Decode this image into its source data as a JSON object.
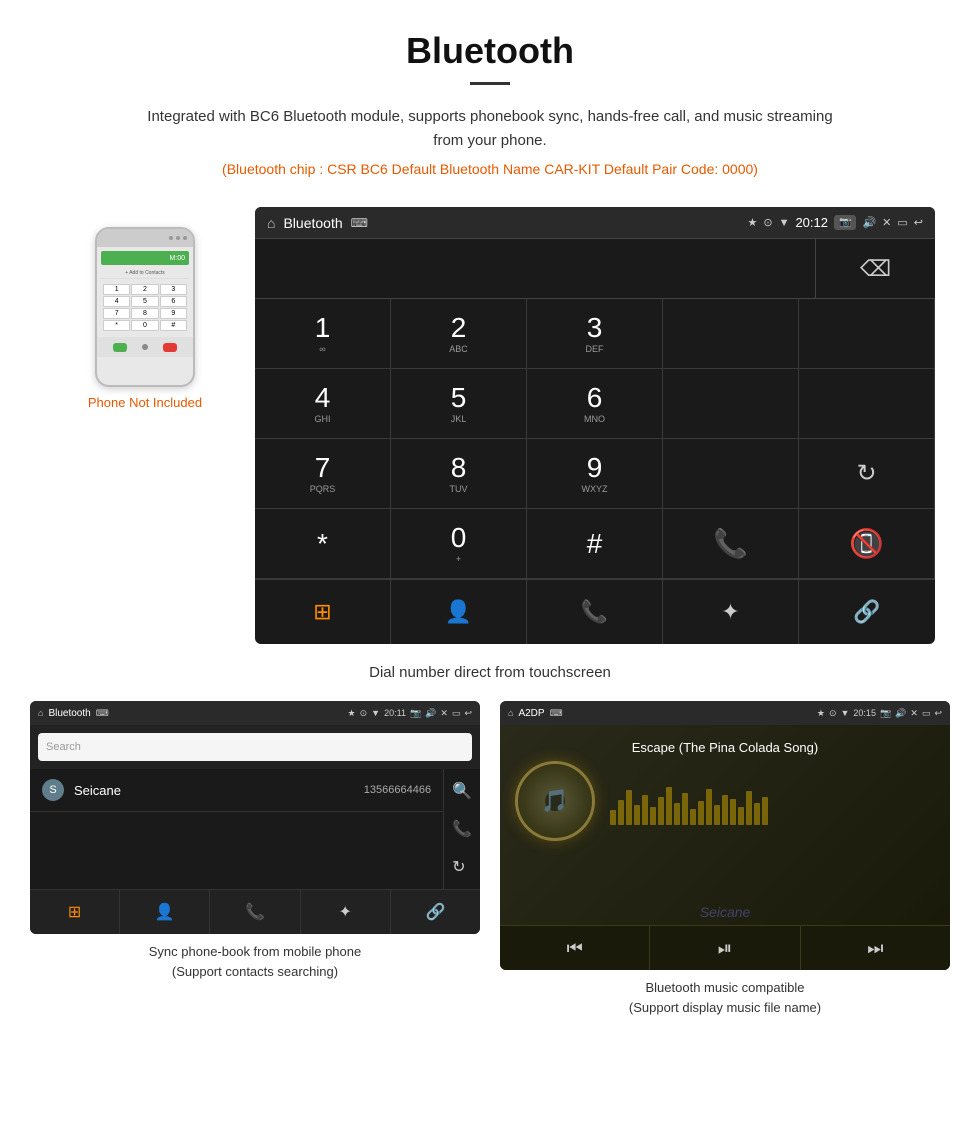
{
  "header": {
    "title": "Bluetooth",
    "description": "Integrated with BC6 Bluetooth module, supports phonebook sync, hands-free call, and music streaming from your phone.",
    "specs": "(Bluetooth chip : CSR BC6   Default Bluetooth Name CAR-KIT    Default Pair Code: 0000)"
  },
  "dial_screen": {
    "status_bar": {
      "title": "Bluetooth",
      "usb_icon": "⌨",
      "time": "20:12",
      "icons": [
        "★",
        "⊙",
        "▼"
      ]
    },
    "keys": [
      {
        "num": "1",
        "alpha": "∞"
      },
      {
        "num": "2",
        "alpha": "ABC"
      },
      {
        "num": "3",
        "alpha": "DEF"
      },
      {
        "num": "",
        "alpha": ""
      },
      {
        "num": "⌫",
        "alpha": ""
      },
      {
        "num": "4",
        "alpha": "GHI"
      },
      {
        "num": "5",
        "alpha": "JKL"
      },
      {
        "num": "6",
        "alpha": "MNO"
      },
      {
        "num": "",
        "alpha": ""
      },
      {
        "num": "",
        "alpha": ""
      },
      {
        "num": "7",
        "alpha": "PQRS"
      },
      {
        "num": "8",
        "alpha": "TUV"
      },
      {
        "num": "9",
        "alpha": "WXYZ"
      },
      {
        "num": "",
        "alpha": ""
      },
      {
        "num": "↻",
        "alpha": ""
      },
      {
        "num": "*",
        "alpha": ""
      },
      {
        "num": "0",
        "alpha": "+"
      },
      {
        "num": "#",
        "alpha": ""
      },
      {
        "num": "📞",
        "alpha": ""
      },
      {
        "num": "📵",
        "alpha": ""
      }
    ],
    "toolbar": [
      "⊞",
      "👤",
      "📞",
      "✦",
      "🔗"
    ]
  },
  "dial_caption": "Dial number direct from touchscreen",
  "phone_not_included": "Phone Not Included",
  "phonebook_screen": {
    "status_bar_title": "Bluetooth",
    "status_bar_time": "20:11",
    "search_placeholder": "Search",
    "contact_name": "Seicane",
    "contact_number": "13566664466",
    "contact_letter": "S",
    "toolbar_icons": [
      "⊞",
      "👤",
      "📞",
      "✦",
      "🔗"
    ]
  },
  "music_screen": {
    "status_bar_title": "A2DP",
    "status_bar_time": "20:15",
    "song_title": "Escape (The Pina Colada Song)",
    "toolbar_icons": [
      "⏮",
      "⏯",
      "⏭"
    ]
  },
  "phonebook_caption": {
    "line1": "Sync phone-book from mobile phone",
    "line2": "(Support contacts searching)"
  },
  "music_caption": {
    "line1": "Bluetooth music compatible",
    "line2": "(Support display music file name)"
  }
}
